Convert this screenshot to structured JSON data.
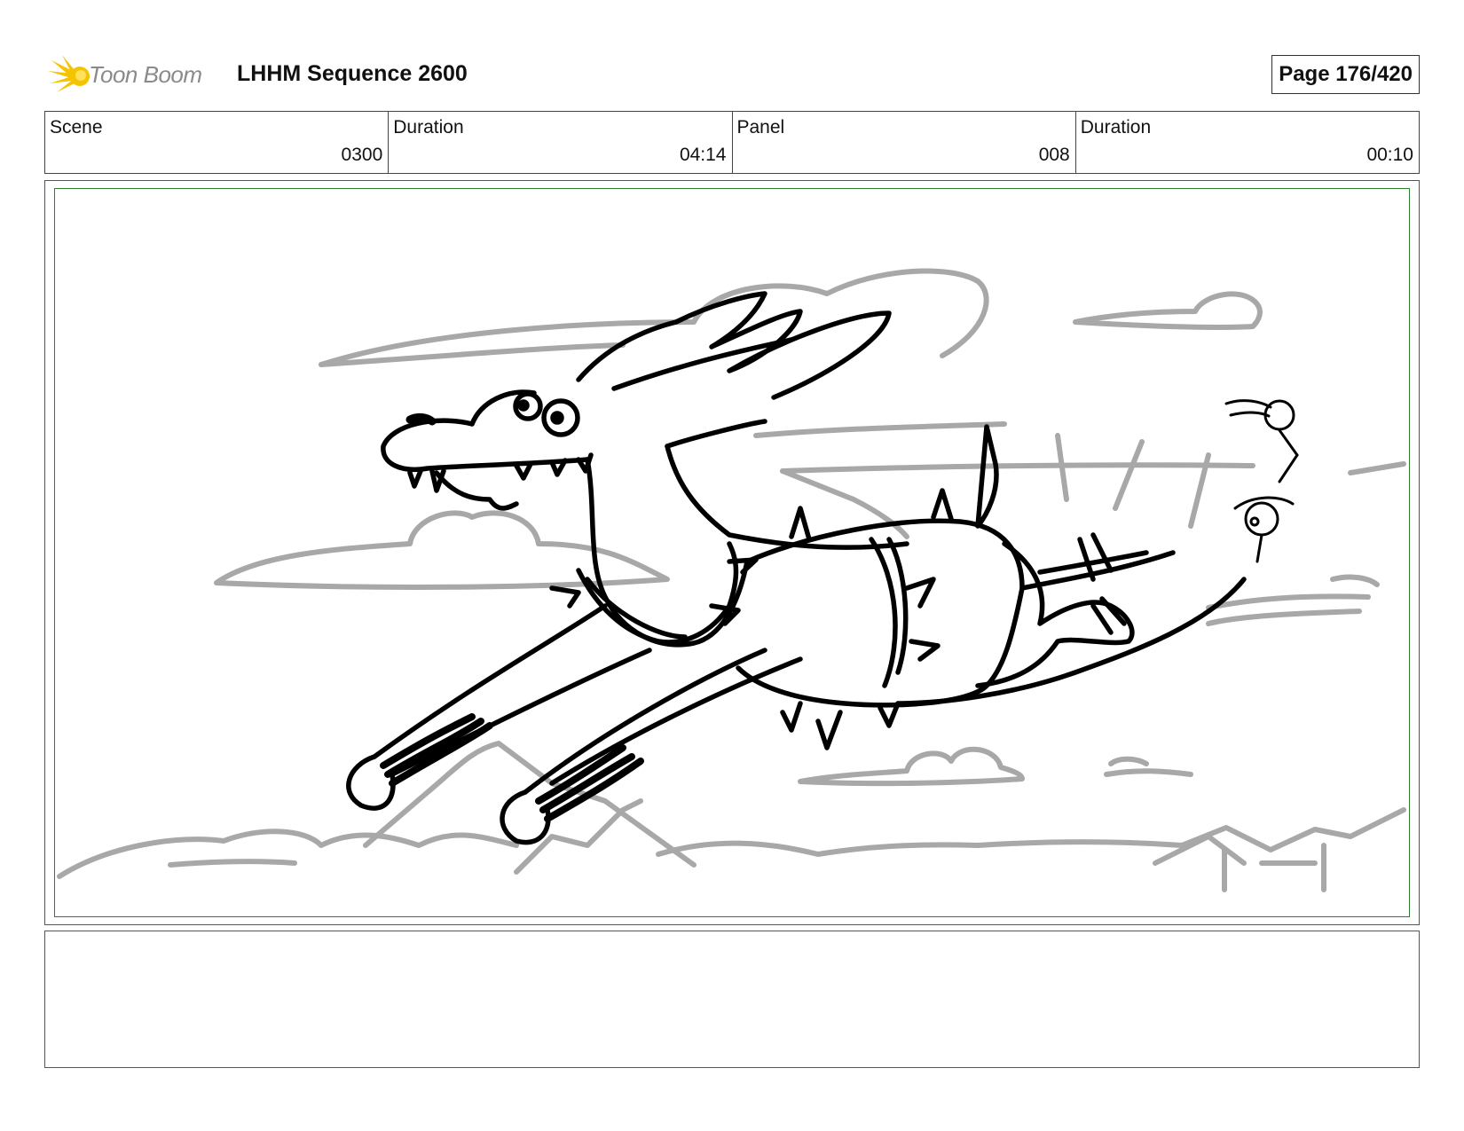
{
  "header": {
    "logo_text": "Toon Boom",
    "sequence_title": "LHHM Sequence 2600",
    "page_label": "Page 176/420"
  },
  "info": {
    "scene_label": "Scene",
    "scene_value": "0300",
    "scene_duration_label": "Duration",
    "scene_duration_value": "04:14",
    "panel_label": "Panel",
    "panel_value": "008",
    "panel_duration_label": "Duration",
    "panel_duration_value": "00:10"
  },
  "panel": {
    "image_icon": "storyboard-sketch",
    "safe_area_color": "#2e7d32",
    "sketch_line_color": "#000000",
    "background_line_color": "#a8a8a8"
  },
  "notes": {
    "text": ""
  }
}
